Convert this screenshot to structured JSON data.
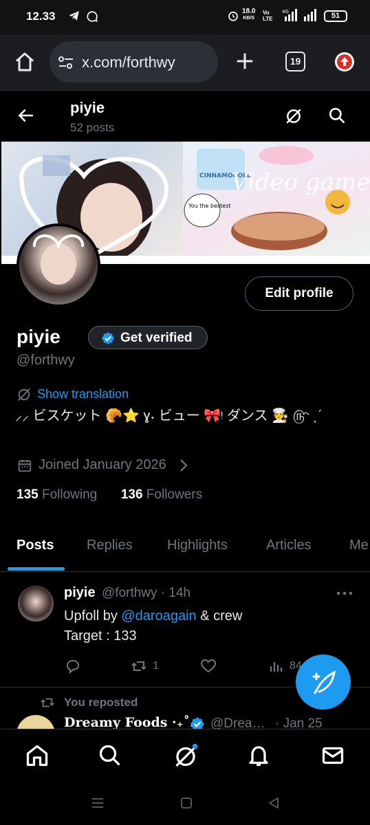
{
  "status_bar": {
    "time": "12.33",
    "net_speed": "18.0",
    "net_unit": "KB/S",
    "volte": "Vo LTE",
    "network": "4G",
    "battery": "51"
  },
  "browser": {
    "url": "x.com/forthwy",
    "tab_count": "19"
  },
  "header": {
    "name": "piyie",
    "posts_count": "52 posts"
  },
  "profile": {
    "display_name": "piyie",
    "verified_label": "Get verified",
    "handle": "@forthwy",
    "translation_label": "Show translation",
    "bio": "⸝⸝ ビスケット 🥐⭐ ɣ˖ ビュー 🎀ᵎ ダンス 🧑‍🍳 ௹ ˎˊ",
    "joined": "Joined January 2026",
    "edit_label": "Edit profile",
    "following_count": "135",
    "following_label": "Following",
    "followers_count": "136",
    "followers_label": "Followers",
    "banner_sticker_1": "You the bestest",
    "banner_sticker_2": "CINNAMOROLL",
    "banner_text": "Video games"
  },
  "tabs": [
    "Posts",
    "Replies",
    "Highlights",
    "Articles",
    "Me"
  ],
  "post": {
    "name": "piyie",
    "handle": "@forthwy",
    "time": "· 14h",
    "line1_prefix": "Upfoll by ",
    "mention": "@daroagain",
    "line1_suffix": " & crew",
    "line2": "Target : 133",
    "retweets": "1",
    "views": "84"
  },
  "repost": {
    "label": "You reposted",
    "name": "Dreamy Foods ·₊˚…",
    "handle": "@Drea…",
    "date": "· Jan 25"
  },
  "colors": {
    "accent": "#1d9bf0",
    "background": "#000000",
    "muted": "#71767b"
  }
}
